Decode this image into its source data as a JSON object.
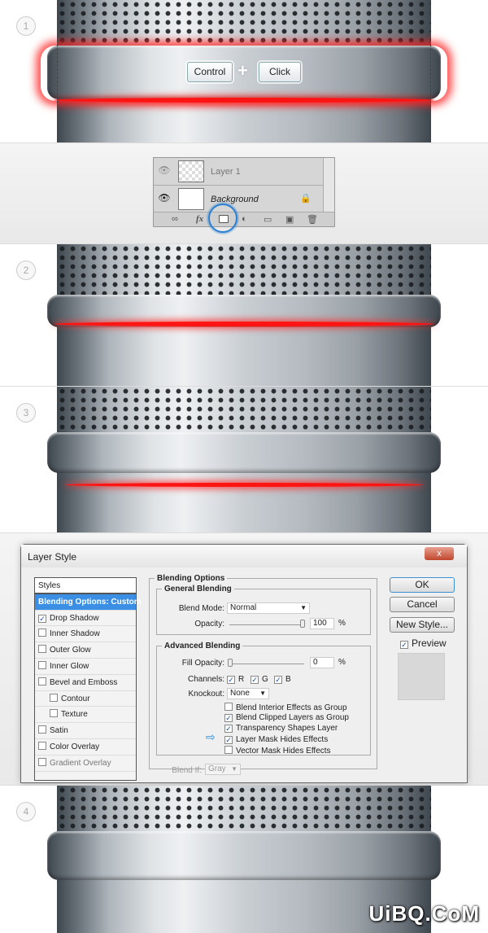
{
  "steps": [
    "1",
    "2",
    "3",
    "4"
  ],
  "step1": {
    "key1": "Control",
    "plus": "+",
    "key2": "Click"
  },
  "layers": {
    "rows": [
      {
        "name": "Layer 1",
        "locked": false
      },
      {
        "name": "Background",
        "locked": true
      }
    ],
    "icons": [
      "link-icon",
      "fx-icon",
      "add-layer-mask-icon",
      "adjustment-layer-icon",
      "group-folder-icon",
      "new-layer-icon",
      "trash-icon"
    ],
    "fx": "fx",
    "highlight_color": "#2a7fd0"
  },
  "dialog": {
    "title": "Layer Style",
    "close": "x",
    "styles": {
      "header": "Styles",
      "items": [
        {
          "label": "Blending Options: Custom",
          "selected": true
        },
        {
          "label": "Drop Shadow",
          "checked": true
        },
        {
          "label": "Inner Shadow",
          "checked": false
        },
        {
          "label": "Outer Glow",
          "checked": false
        },
        {
          "label": "Inner Glow",
          "checked": false
        },
        {
          "label": "Bevel and Emboss",
          "checked": false
        },
        {
          "label": "Contour",
          "checked": false,
          "sub": true
        },
        {
          "label": "Texture",
          "checked": false,
          "sub": true
        },
        {
          "label": "Satin",
          "checked": false
        },
        {
          "label": "Color Overlay",
          "checked": false
        },
        {
          "label": "Gradient Overlay",
          "checked": false
        }
      ]
    },
    "blending": {
      "title": "Blending Options",
      "general": "General Blending",
      "blend_mode_label": "Blend Mode:",
      "blend_mode": "Normal",
      "opacity_label": "Opacity:",
      "opacity": "100",
      "pct": "%",
      "advanced": "Advanced Blending",
      "fill_opacity_label": "Fill Opacity:",
      "fill_opacity": "0",
      "channels_label": "Channels:",
      "channels": [
        "R",
        "G",
        "B"
      ],
      "knockout_label": "Knockout:",
      "knockout": "None",
      "options": [
        {
          "label": "Blend Interior Effects as Group",
          "checked": false
        },
        {
          "label": "Blend Clipped Layers as Group",
          "checked": true
        },
        {
          "label": "Transparency Shapes Layer",
          "checked": true
        },
        {
          "label": "Layer Mask Hides Effects",
          "checked": true,
          "arrow": true
        },
        {
          "label": "Vector Mask Hides Effects",
          "checked": false
        }
      ],
      "blend_if_label": "Blend If:",
      "blend_if": "Gray"
    },
    "buttons": {
      "ok": "OK",
      "cancel": "Cancel",
      "new_style": "New Style...",
      "preview": "Preview"
    }
  },
  "watermark": "UiBQ.CoM",
  "colors": {
    "glow": "#ff1414",
    "selection": "#3a8fe4"
  }
}
